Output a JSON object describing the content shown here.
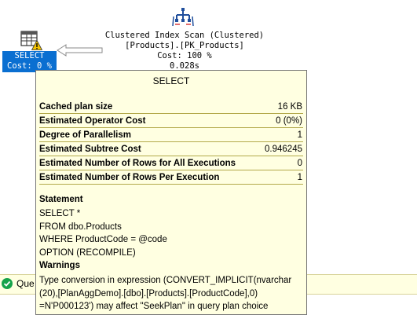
{
  "plan": {
    "scan_node": {
      "line1": "Clustered Index Scan (Clustered)",
      "line2": "[Products].[PK_Products]",
      "line3": "Cost: 100 %",
      "line4": "0.028s"
    },
    "select_node": {
      "line1": "SELECT",
      "line2": "Cost: 0 %"
    }
  },
  "tooltip": {
    "title": "SELECT",
    "rows": [
      {
        "label": "Cached plan size",
        "value": "16 KB"
      },
      {
        "label": "Estimated Operator Cost",
        "value": "0 (0%)"
      },
      {
        "label": "Degree of Parallelism",
        "value": "1"
      },
      {
        "label": "Estimated Subtree Cost",
        "value": "0.946245"
      },
      {
        "label": "Estimated Number of Rows for All Executions",
        "value": "0"
      },
      {
        "label": "Estimated Number of Rows Per Execution",
        "value": "1"
      }
    ],
    "statement_title": "Statement",
    "statement_lines": [
      "SELECT *",
      "FROM dbo.Products",
      "WHERE ProductCode = @code",
      "OPTION (RECOMPILE)"
    ],
    "warnings_title": "Warnings",
    "warning_lines": [
      "Type conversion in expression (CONVERT_IMPLICIT(nvarchar",
      "(20),[PlanAggDemo].[dbo].[Products].[ProductCode],0)",
      "=N'P000123') may affect \"SeekPlan\" in query plan choice"
    ]
  },
  "statusbar": {
    "text": "Que"
  },
  "colors": {
    "select_highlight": "#0a6fd1",
    "tooltip_bg": "#ffffe1",
    "row_underline": "#b3a94a",
    "status_ok": "#16a34a",
    "warning": "#f5c400"
  },
  "icons": {
    "scan": "clustered-index-scan-icon",
    "select": "select-table-icon",
    "warning": "warning-triangle-icon",
    "status": "success-check-icon"
  }
}
